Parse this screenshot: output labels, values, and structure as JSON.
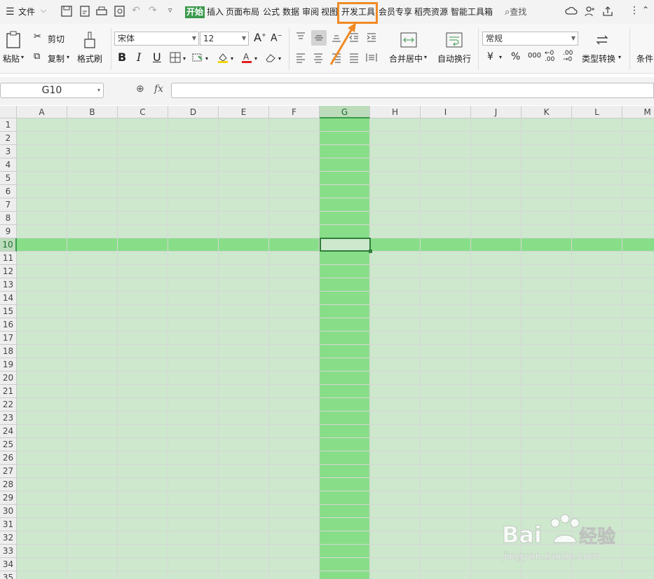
{
  "menu": {
    "file": "文件",
    "tabs": [
      "开始",
      "插入",
      "页面布局",
      "公式",
      "数据",
      "审阅",
      "视图",
      "开发工具",
      "会员专享",
      "稻壳资源",
      "智能工具箱"
    ],
    "active_tab": "开始",
    "highlighted_tab": "开发工具",
    "search": "查找"
  },
  "ribbon": {
    "paste": "粘贴",
    "cut": "剪切",
    "copy": "复制",
    "format_painter": "格式刷",
    "font_name": "宋体",
    "font_size": "12",
    "bold": "B",
    "italic": "I",
    "underline": "U",
    "merge_center": "合并居中",
    "wrap_text": "自动换行",
    "number_format": "常规",
    "currency": "¥",
    "percent": "%",
    "thousands": "000",
    "type_convert": "类型转换",
    "conditional": "条件"
  },
  "formula_bar": {
    "name_box": "G10",
    "fx": "fx",
    "value": ""
  },
  "sheet": {
    "columns": [
      "A",
      "B",
      "C",
      "D",
      "E",
      "F",
      "G",
      "H",
      "I",
      "J",
      "K",
      "L",
      "M"
    ],
    "rows": [
      "1",
      "2",
      "3",
      "4",
      "5",
      "6",
      "7",
      "8",
      "9",
      "10",
      "11",
      "12",
      "13",
      "14",
      "15",
      "16",
      "17",
      "18",
      "19",
      "20",
      "21",
      "22",
      "23",
      "24",
      "25",
      "26",
      "27",
      "28",
      "29",
      "30",
      "31",
      "32",
      "33",
      "34",
      "35"
    ],
    "selected_column": "G",
    "selected_row": "10",
    "active_cell": "G10"
  },
  "watermark": {
    "logo": "Bai du 经验",
    "url": "jingyan.baidu.com"
  },
  "colors": {
    "accent": "#3c9a4d",
    "highlight_box": "#f08a24",
    "grid_bg": "#cde8cd",
    "band": "#88de88"
  }
}
